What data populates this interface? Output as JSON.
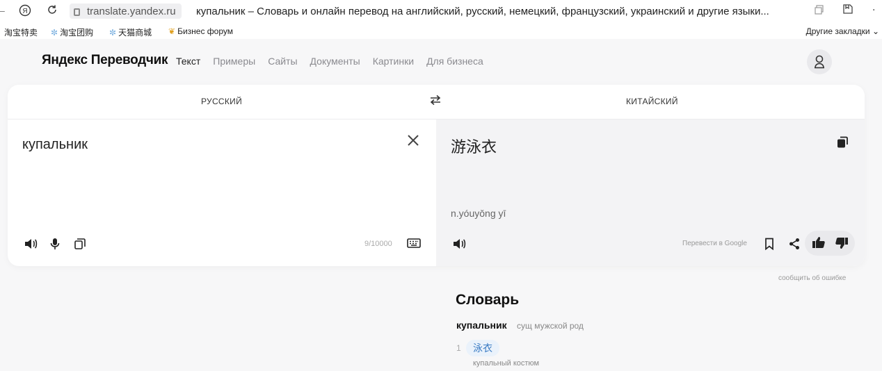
{
  "browser": {
    "url": "translate.yandex.ru",
    "page_title": "купальник – Словарь и онлайн перевод на английский, русский, немецкий, французский, украинский и другие языки...",
    "bookmarks": [
      {
        "label": "淘宝特卖",
        "icon": "snowflake-icon"
      },
      {
        "label": "淘宝团购",
        "icon": "snowflake-icon"
      },
      {
        "label": "天猫商城",
        "icon": "snowflake-icon"
      },
      {
        "label": "Бизнес форум",
        "icon": "bulb-icon"
      }
    ],
    "other_bookmarks": "Другие закладки"
  },
  "header": {
    "logo": "Яндекс Переводчик",
    "nav": [
      "Текст",
      "Примеры",
      "Сайты",
      "Документы",
      "Картинки",
      "Для бизнеса"
    ],
    "active_nav": "Текст"
  },
  "translator": {
    "source_lang": "РУССКИЙ",
    "target_lang": "КИТАЙСКИЙ",
    "source_text": "купальник",
    "translation": "游泳衣",
    "transliteration": "n.yóuyǒng yī",
    "counter": "9/10000",
    "google_link": "Перевести в Google",
    "report_error": "сообщить об ошибке"
  },
  "dictionary": {
    "title": "Словарь",
    "headword": "купальник",
    "pos": "сущ  мужской род",
    "entries": [
      {
        "num": "1",
        "translation": "泳衣",
        "gloss": "купальный костюм"
      }
    ]
  },
  "colors": {
    "accent_blue": "#3b7cc4",
    "panel_gray": "#f3f3f5"
  }
}
